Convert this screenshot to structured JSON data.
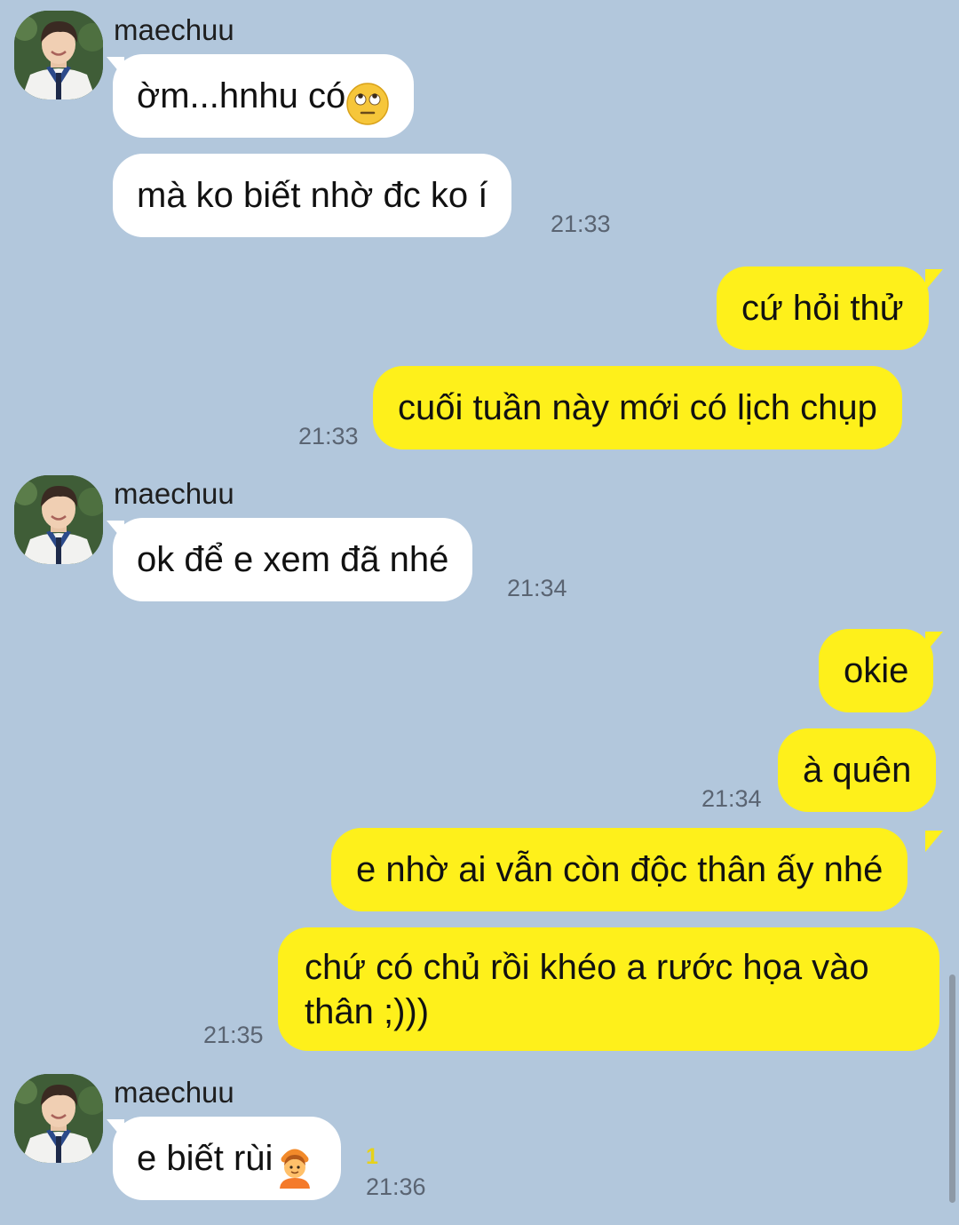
{
  "sender": {
    "name": "maechuu"
  },
  "messages": {
    "m1": {
      "text": "ờm...hnhu có",
      "emoji": "eye-roll-face-emoji"
    },
    "m2": {
      "text": "mà ko biết nhờ đc ko í",
      "time": "21:33"
    },
    "m3": {
      "text": "cứ hỏi thử"
    },
    "m4": {
      "text": "cuối tuần này mới có lịch chụp",
      "time": "21:33"
    },
    "m5": {
      "text": "ok để e xem đã nhé",
      "time": "21:34"
    },
    "m6": {
      "text": "okie"
    },
    "m7": {
      "text": "à quên",
      "time": "21:34"
    },
    "m8": {
      "text": "e nhờ ai vẫn còn độc thân ấy nhé"
    },
    "m9": {
      "text": "chứ có chủ rồi khéo a rước họa vào thân ;)))",
      "time": "21:35"
    },
    "m10": {
      "text": "e biết rùi",
      "emoji": "person-gesturing-ok-emoji",
      "time": "21:36",
      "unread": "1"
    }
  },
  "colors": {
    "background": "#b2c7dc",
    "incoming_bubble": "#ffffff",
    "outgoing_bubble": "#fef01b",
    "timestamp": "#5a6472",
    "unread_count": "#e6d21a"
  }
}
